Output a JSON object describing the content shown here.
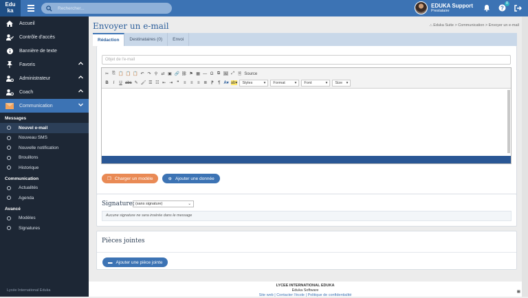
{
  "header": {
    "logo_top": "Edu",
    "logo_bottom": "ka",
    "search_placeholder": "Rechercher...",
    "user_name": "EDUKA Support",
    "user_role": "Prestataire",
    "help_badge": "8"
  },
  "sidebar": {
    "items": [
      {
        "label": "Accueil",
        "icon": "home-icon"
      },
      {
        "label": "Contrôle d'accès",
        "icon": "user-check-icon"
      },
      {
        "label": "Bannière de texte",
        "icon": "info-icon"
      },
      {
        "label": "Favoris",
        "icon": "pin-icon"
      },
      {
        "label": "Administrateur",
        "icon": "user-gear-icon"
      },
      {
        "label": "Coach",
        "icon": "user-gear-icon"
      },
      {
        "label": "Communication",
        "icon": "envelope-icon"
      }
    ],
    "sections": [
      {
        "title": "Messages",
        "items": [
          "Nouvel e-mail",
          "Nouveau SMS",
          "Nouvelle notification",
          "Brouillons",
          "Historique"
        ]
      },
      {
        "title": "Communication",
        "items": [
          "Actualités",
          "Agenda"
        ]
      },
      {
        "title": "Avancé",
        "items": [
          "Modèles",
          "Signatures"
        ]
      }
    ],
    "footer": "Lycée International Eduka"
  },
  "page": {
    "title": "Envoyer un e-mail",
    "breadcrumb": "Eduka Suite > Communication > Envoyer un e-mail"
  },
  "tabs": [
    "Rédaction",
    "Destinataires (0)",
    "Envoi"
  ],
  "form": {
    "subject_placeholder": "Objet de l'e-mail",
    "source_label": "Source",
    "styles": "Styles",
    "format": "Format",
    "font": "Font",
    "size": "Size",
    "load_template": "Charger un modèle",
    "add_data": "Ajouter une donnée"
  },
  "signature": {
    "label": "Signature:",
    "selected": "(sans signature)",
    "note": "Aucune signature ne sera insérée dans le message"
  },
  "attachments": {
    "title": "Pièces jointes",
    "add_button": "Ajouter une pièce jointe"
  },
  "footer": {
    "school": "LYCEE INTERNATIONAL EDUKA",
    "company": "Eduka Software",
    "links": "Site web | Contacter l'école | Politique de confidentialité"
  }
}
